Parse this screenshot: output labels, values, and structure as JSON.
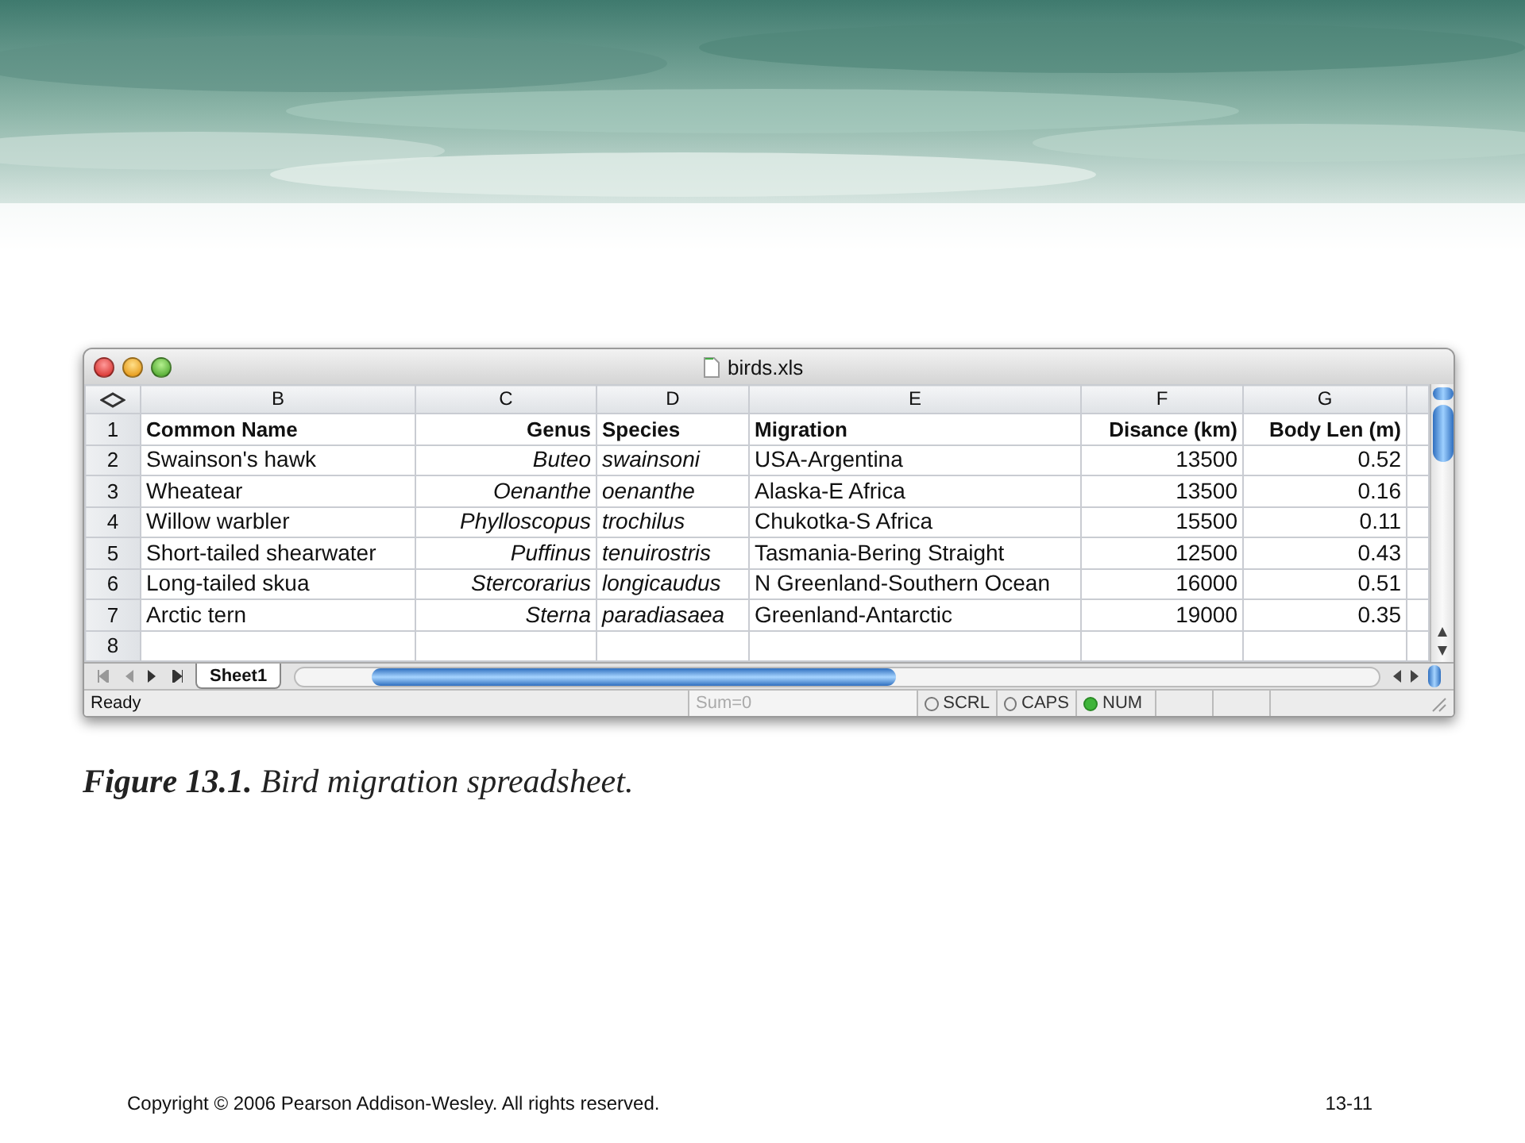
{
  "window": {
    "title": "birds.xls"
  },
  "columns": [
    {
      "letter": "B",
      "kind": "text"
    },
    {
      "letter": "C",
      "kind": "genus"
    },
    {
      "letter": "D",
      "kind": "species"
    },
    {
      "letter": "E",
      "kind": "text"
    },
    {
      "letter": "F",
      "kind": "number"
    },
    {
      "letter": "G",
      "kind": "number"
    }
  ],
  "rows": [
    {
      "number": "1",
      "kind": "header",
      "cells": [
        "Common Name",
        "Genus",
        "Species",
        "Migration",
        "Disance (km)",
        "Body Len (m)"
      ]
    },
    {
      "number": "2",
      "kind": "data",
      "cells": [
        "Swainson's hawk",
        "Buteo",
        "swainsoni",
        "USA-Argentina",
        "13500",
        "0.52"
      ]
    },
    {
      "number": "3",
      "kind": "data",
      "cells": [
        "Wheatear",
        "Oenanthe",
        "oenanthe",
        "Alaska-E Africa",
        "13500",
        "0.16"
      ]
    },
    {
      "number": "4",
      "kind": "data",
      "cells": [
        "Willow warbler",
        "Phylloscopus",
        "trochilus",
        "Chukotka-S Africa",
        "15500",
        "0.11"
      ]
    },
    {
      "number": "5",
      "kind": "data",
      "cells": [
        "Short-tailed shearwater",
        "Puffinus",
        "tenuirostris",
        "Tasmania-Bering Straight",
        "12500",
        "0.43"
      ]
    },
    {
      "number": "6",
      "kind": "data",
      "cells": [
        "Long-tailed skua",
        "Stercorarius",
        "longicaudus",
        "N Greenland-Southern Ocean",
        "16000",
        "0.51"
      ]
    },
    {
      "number": "7",
      "kind": "data",
      "cells": [
        "Arctic tern",
        "Sterna",
        "paradiasaea",
        "Greenland-Antarctic",
        "19000",
        "0.35"
      ]
    },
    {
      "number": "8"
    }
  ],
  "sheet_tabs": [
    {
      "label": "Sheet1",
      "selected": true
    }
  ],
  "status_bar": {
    "text": "Ready",
    "sum": "Sum=0",
    "indicators": [
      {
        "label": "SCRL",
        "on": false
      },
      {
        "label": "CAPS",
        "on": false
      },
      {
        "label": "NUM",
        "on": true
      }
    ]
  },
  "caption": "**Figure 13.1.** Bird migration spreadsheet.",
  "footer": {
    "copyright": "Copyright © 2006 Pearson Addison-Wesley. All rights reserved.",
    "page": "13-11"
  }
}
